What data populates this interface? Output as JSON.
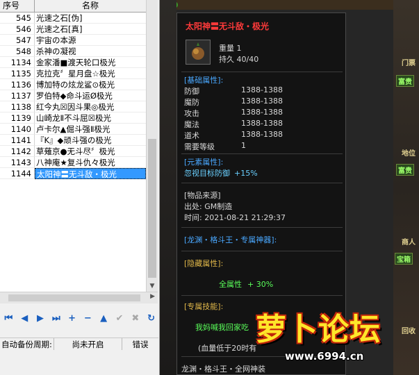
{
  "editor": {
    "col_id": "序号",
    "col_name": "名称",
    "rows": [
      {
        "id": "545",
        "name": "光速之石[伪]"
      },
      {
        "id": "546",
        "name": "光速之石[真]"
      },
      {
        "id": "547",
        "name": "宇宙の本源"
      },
      {
        "id": "548",
        "name": "杀神の凝视"
      },
      {
        "id": "1134",
        "name": "金家潘■渡天轮口极光"
      },
      {
        "id": "1135",
        "name": "克拉克〞星月盘☆极光"
      },
      {
        "id": "1136",
        "name": "博加特の炫龙鲨⊙极光"
      },
      {
        "id": "1137",
        "name": "罗伯特◆命斗运Ø极光"
      },
      {
        "id": "1138",
        "name": "红今丸☒因斗果◎极光"
      },
      {
        "id": "1139",
        "name": "山崎龙Ⅱ不斗屈☒极光"
      },
      {
        "id": "1140",
        "name": "卢卡尔▲倔斗强Ⅱ极光"
      },
      {
        "id": "1141",
        "name": "『K』◆顽斗强の极光"
      },
      {
        "id": "1142",
        "name": "草薙京●无斗尽〞极光"
      },
      {
        "id": "1143",
        "name": "八神庵★复斗仇々极光"
      },
      {
        "id": "1144",
        "name": "太阳神〓无斗敌・极光"
      }
    ],
    "selected_index": 14,
    "status_label": "自动备份周期:",
    "status_value": "尚未开启",
    "status_error": "错误"
  },
  "tooltip": {
    "title": "太阳神〓无斗敌・极光",
    "weight": "重量 1",
    "durability": "持久 40/40",
    "base_section": "[基础属性]:",
    "attrs": [
      {
        "k": "防御",
        "v": "1388-1388"
      },
      {
        "k": "魔防",
        "v": "1388-1388"
      },
      {
        "k": "攻击",
        "v": "1388-1388"
      },
      {
        "k": "魔法",
        "v": "1388-1388"
      },
      {
        "k": "道术",
        "v": "1388-1388"
      },
      {
        "k": "需要等级",
        "v": "1"
      }
    ],
    "elem_section": "[元素属性]:",
    "elem_name": "忽视目标防御",
    "elem_value": "+15%",
    "source_section": "[物品来源]",
    "source_from": "出处: GM制造",
    "source_time": "时间: 2021-08-21 21:29:37",
    "set_name": "[龙渊・格斗王・专属神器]:",
    "hidden_section": "[隐藏属性]:",
    "full_attr": "全属性",
    "full_value": "+ 30%",
    "skill_section": "[专属技能]:",
    "skill_text": "我妈喊我回家吃",
    "blood_text": "(血量低于20时有",
    "bottom_text": "龙渊・格斗王・全网神装"
  },
  "game": {
    "tag1": "门票",
    "tag2": "富贵",
    "tag3": "地位",
    "tag4": "商人",
    "tag5": "回收",
    "tag6": "宝箱"
  },
  "watermark": {
    "logo": "萝卜论坛",
    "url": "www.6994.cn"
  },
  "colors": {
    "selection": "#3399ff",
    "title_red": "#ff3a3a",
    "section_blue": "#4aa8ff",
    "green": "#5aff5a",
    "gold": "#e1b84a"
  }
}
